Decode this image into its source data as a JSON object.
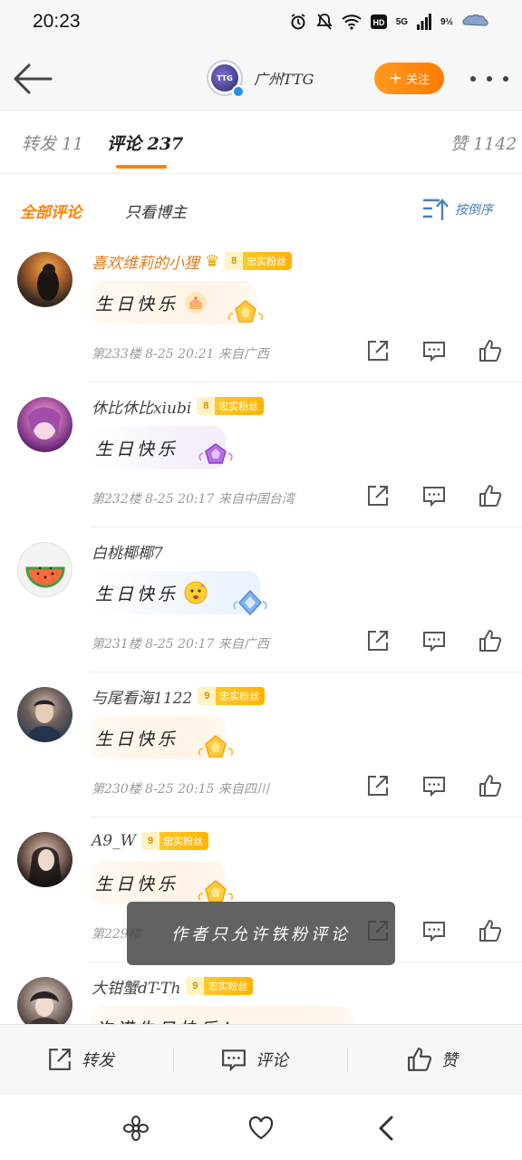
{
  "status_bar": {
    "time": "20:23",
    "signal_label": "5G",
    "network_label": "9½"
  },
  "header": {
    "account_name": "广州TTG",
    "follow_label": "关注"
  },
  "tabs": [
    {
      "label": "转发 11"
    },
    {
      "label": "评论 237"
    },
    {
      "label": "赞 1142"
    }
  ],
  "filters": {
    "all": "全部评论",
    "author_only": "只看博主",
    "sort": "按倒序"
  },
  "comments": [
    {
      "username": "喜欢维莉的小狸",
      "fan_level": "8",
      "fan_label": "忠实粉丝",
      "text": "生日快乐",
      "meta": "第233楼 8-25 20:21 来自广西",
      "deco": "gold"
    },
    {
      "username": "休比休比xiubi",
      "fan_level": "8",
      "fan_label": "忠实粉丝",
      "text": "生日快乐",
      "meta": "第232楼 8-25 20:17 来自中国台湾",
      "deco": "purple"
    },
    {
      "username": "白桃椰椰7",
      "fan_level": "",
      "fan_label": "",
      "text": "生日快乐",
      "meta": "第231楼 8-25 20:17 来自广西",
      "deco": "blue"
    },
    {
      "username": "与尾看海1122",
      "fan_level": "9",
      "fan_label": "忠实粉丝",
      "text": "生日快乐",
      "meta": "第230楼 8-25 20:15 来自四川",
      "deco": "gold"
    },
    {
      "username": "A9_W",
      "fan_level": "9",
      "fan_label": "忠实粉丝",
      "text": "生日快乐",
      "meta": "第229楼",
      "deco": "gold"
    },
    {
      "username": "大钳蟹dT-Th",
      "fan_level": "9",
      "fan_label": "忠实粉丝",
      "text": "许诺生日快乐！",
      "meta": "",
      "deco": "none"
    }
  ],
  "toast": "作者只允许铁粉评论",
  "bottom_bar": {
    "repost": "转发",
    "comment": "评论",
    "like": "赞"
  },
  "colors": {
    "accent": "#ff8200",
    "link_blue": "#4a7fb8",
    "fan_badge": "#ffb300"
  }
}
